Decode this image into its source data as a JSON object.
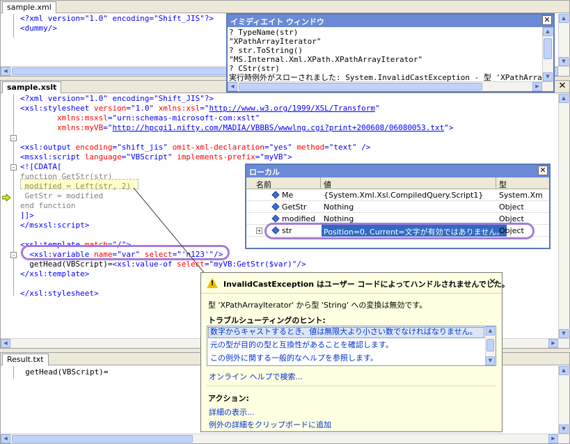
{
  "sample_xml": {
    "tab": "sample.xml",
    "lines": [
      [
        [
          "b",
          "<?xml version=\"1.0\" encoding=\"Shift_JIS\"?>"
        ]
      ],
      [
        [
          "b",
          "<dummy/>"
        ]
      ]
    ]
  },
  "sample_xslt": {
    "tab": "sample.xslt",
    "lines": [
      [
        [
          "b",
          "<?xml version=\"1.0\" encoding=\"Shift_JIS\"?>"
        ]
      ],
      [
        [
          "b",
          "<xsl:stylesheet "
        ],
        [
          "re",
          "version"
        ],
        [
          "b",
          "=\"1.0\" "
        ],
        [
          "re",
          "xmlns:xsl"
        ],
        [
          "b",
          "=\""
        ],
        [
          "lnk",
          "http://www.w3.org/1999/XSL/Transform"
        ],
        [
          "b",
          "\""
        ]
      ],
      [
        [
          "b",
          "        "
        ],
        [
          "re",
          "xmlns:msxsl"
        ],
        [
          "b",
          "=\"urn:schemas-microsoft-com:xslt\""
        ]
      ],
      [
        [
          "b",
          "        "
        ],
        [
          "re",
          "xmlns:myVB"
        ],
        [
          "b",
          "=\""
        ],
        [
          "lnk",
          "http://hpcgi1.nifty.com/MADIA/VBBBS/wwwlng.cgi?print+200608/06080053.txt"
        ],
        [
          "b",
          "\">"
        ]
      ],
      [
        [
          "k",
          ""
        ]
      ],
      [
        [
          "b",
          "<xsl:output "
        ],
        [
          "re",
          "encoding"
        ],
        [
          "b",
          "=\"shift_jis\" "
        ],
        [
          "re",
          "omit-xml-declaration"
        ],
        [
          "b",
          "=\"yes\" "
        ],
        [
          "re",
          "method"
        ],
        [
          "b",
          "=\"text\" />"
        ]
      ],
      [
        [
          "b",
          "<msxsl:script "
        ],
        [
          "re",
          "language"
        ],
        [
          "b",
          "=\"VBScript\" "
        ],
        [
          "re",
          "implements-prefix"
        ],
        [
          "b",
          "=\"myVB\">"
        ]
      ],
      [
        [
          "b",
          "<![CDATA["
        ]
      ],
      [
        [
          "g",
          "function GetStr(str)"
        ]
      ],
      [
        [
          "k",
          " modified = Left(str, 2) "
        ]
      ],
      [
        [
          "g",
          " GetStr = modified"
        ]
      ],
      [
        [
          "g",
          "end function"
        ]
      ],
      [
        [
          "b",
          "]]>"
        ]
      ],
      [
        [
          "b",
          "</msxsl:script>"
        ]
      ],
      [
        [
          "k",
          ""
        ]
      ],
      [
        [
          "b",
          "<xsl:template "
        ],
        [
          "re",
          "match"
        ],
        [
          "b",
          "=\"/\">"
        ]
      ],
      [
        [
          "b",
          "  <xsl:variable "
        ],
        [
          "re",
          "name"
        ],
        [
          "b",
          "=\"var\" "
        ],
        [
          "re",
          "select"
        ],
        [
          "b",
          "=\"'n123'\"/>"
        ]
      ],
      [
        [
          "k",
          "  getHead(VBScript)="
        ],
        [
          "b",
          "<xsl:value-of "
        ],
        [
          "re",
          "select"
        ],
        [
          "b",
          "=\"myVB:GetStr($var)\"/>"
        ]
      ],
      [
        [
          "b",
          "</xsl:template>"
        ]
      ],
      [
        [
          "k",
          ""
        ]
      ],
      [
        [
          "b",
          "</xsl:stylesheet>"
        ]
      ]
    ]
  },
  "result": {
    "tab": "Result.txt",
    "lines": [
      "  getHead(VBScript)="
    ]
  },
  "immediate": {
    "title": "イミディエイト ウィンドウ",
    "lines": [
      "? TypeName(str)",
      "\"XPathArrayIterator\"",
      "? str.ToString()",
      "\"MS.Internal.Xml.XPath.XPathArrayIterator\"",
      "? CStr(str)",
      "実行時例外がスローされました: System.InvalidCastException - 型 'XPathArrayI"
    ]
  },
  "locals": {
    "title": "ローカル",
    "columns": [
      "名前",
      "値",
      "型"
    ],
    "rows": [
      {
        "name": "Me",
        "value": "{System.Xml.Xsl.CompiledQuery.Script1}",
        "type": "System.Xm"
      },
      {
        "name": "GetStr",
        "value": "Nothing",
        "type": "Object"
      },
      {
        "name": "modified",
        "value": "Nothing",
        "type": "Object"
      },
      {
        "name": "str",
        "value": "Position=0, Current=文字が有効ではありません。",
        "type": "Object"
      }
    ]
  },
  "exception": {
    "title": "InvalidCastException はユーザー コードによってハンドルされませんでした。",
    "message": "型 'XPathArrayIterator' から型 'String' への変換は無効です。",
    "hints_header": "トラブルシューティングのヒント:",
    "hints": [
      "数字からキャストするとき、値は無限大より小さい数でなければなりません。",
      "元の型が目的の型と互換性があることを確認します。",
      "この例外に関する一般的なヘルプを参照します。"
    ],
    "online_help": "オンライン ヘルプで検索...",
    "actions_header": "アクション:",
    "actions": [
      "詳細の表示...",
      "例外の詳細をクリップボードに追加"
    ]
  }
}
